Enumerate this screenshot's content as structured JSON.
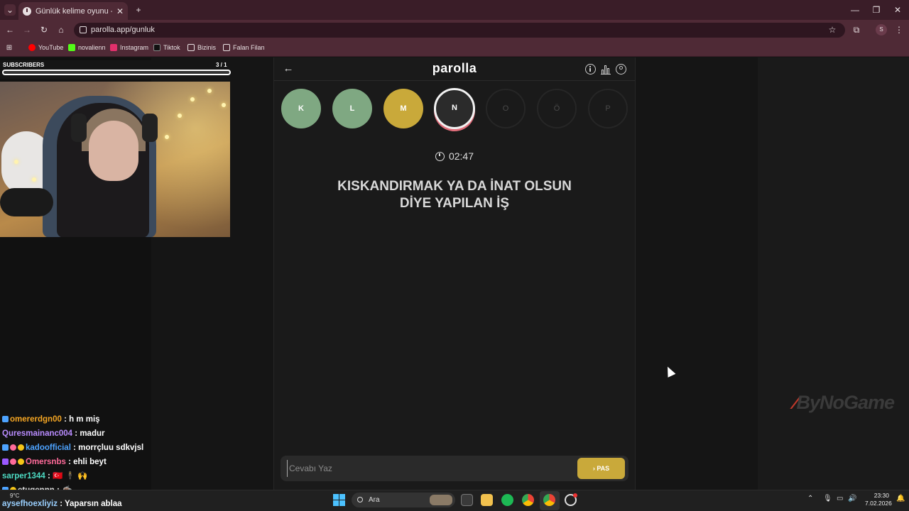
{
  "browser": {
    "tab_title": "Günlük kelime oyunu - parolla",
    "tab_close": "✕",
    "new_tab": "+",
    "url": "parolla.app/gunluk",
    "profile_initial": "S",
    "window_controls": [
      "—",
      "❐",
      "✕"
    ],
    "bookmarks": [
      {
        "label": "YouTube",
        "color": "#ff0000"
      },
      {
        "label": "novalienn",
        "color": "#53fc18"
      },
      {
        "label": "Instagram",
        "color": "#e1306c"
      },
      {
        "label": "Tiktok",
        "color": "#111111"
      },
      {
        "label": "Bizinis",
        "color": "folder"
      },
      {
        "label": "Falan Filan",
        "color": "folder"
      }
    ]
  },
  "stream": {
    "subscribers_label": "SUBSCRIBERS",
    "subscribers_count": "3  / 1",
    "chat": [
      {
        "user": "omererdgn00",
        "color": "#f5a623",
        "message": ": h m miş"
      },
      {
        "user": "Quresmainanc004",
        "color": "#b98cff",
        "message": ": madur"
      },
      {
        "user": "kadoofficial",
        "color": "#4da3ff",
        "message": ": morrçluu sdkvjsl"
      },
      {
        "user": "Omersnbs",
        "color": "#ff6b9a",
        "message": ": ehli beyt"
      },
      {
        "user": "sarper1344",
        "color": "#4ddcc4",
        "message": ": 🇹🇷 🕴 🙌"
      },
      {
        "user": "etugennn",
        "color": "#e0e0e0",
        "message": ": ☕"
      },
      {
        "user": "aysefhoexliyiz",
        "color": "#9ad0ff",
        "message": ": Yaparsın ablaa"
      }
    ],
    "sponsor": "ByNoGame"
  },
  "game": {
    "logo": "parolla",
    "back_icon": "←",
    "letters": [
      {
        "letter": "K",
        "state": "correct"
      },
      {
        "letter": "L",
        "state": "correct"
      },
      {
        "letter": "M",
        "state": "passed"
      },
      {
        "letter": "N",
        "state": "active"
      },
      {
        "letter": "O",
        "state": "pending"
      },
      {
        "letter": "Ö",
        "state": "pending"
      },
      {
        "letter": "P",
        "state": "pending"
      }
    ],
    "timer": "02:47",
    "question_line1": "KISKANDIRMAK YA DA İNAT OLSUN",
    "question_line2": "DİYE YAPILAN İŞ",
    "answer_placeholder": "Cevabı Yaz",
    "pass_button": "› PAS",
    "colors": {
      "correct": "#7fa882",
      "passed": "#c9a93a",
      "accent_ring": "#e06d7a"
    }
  },
  "taskbar": {
    "weather": "9°C",
    "search_placeholder": "Ara",
    "time": "23:30",
    "date": "7.02.2026"
  }
}
